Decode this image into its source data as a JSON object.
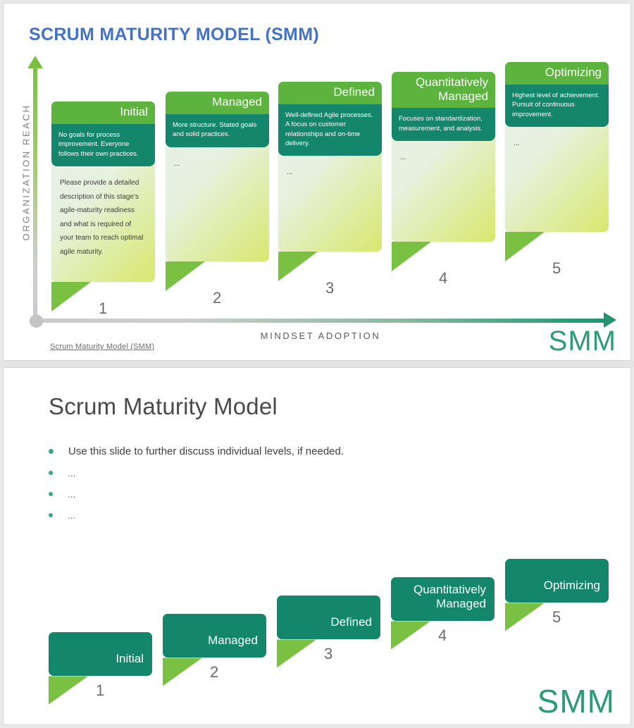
{
  "slide1": {
    "title": "SCRUM MATURITY MODEL  (SMM)",
    "y_axis_label": "ORGANIZATION REACH",
    "x_axis_label": "MINDSET ADOPTION",
    "footer_link": "Scrum Maturity Model  (SMM)",
    "logo": "SMM",
    "accent_blue": "#4472C4",
    "accent_green": "#7ac143",
    "accent_teal": "#13866c",
    "header_green": "#5cb33d",
    "steps": [
      {
        "number": "1",
        "title": "Initial",
        "description": "No goals for process improvement. Everyone follows their own practices.",
        "body": "Please provide a detailed description of this stage's agile-maturity readiness and what is required of your team to reach optimal agile maturity."
      },
      {
        "number": "2",
        "title": "Managed",
        "description": "More structure. Stated goals and solid practices.",
        "body": "..."
      },
      {
        "number": "3",
        "title": "Defined",
        "description": "Well-defined Agile processes. A focus on customer relationships and on-time delivery.",
        "body": "..."
      },
      {
        "number": "4",
        "title": "Quantitatively Managed",
        "description": "Focuses on standardization, measurement, and analysis.",
        "body": "..."
      },
      {
        "number": "5",
        "title": "Optimizing",
        "description": "Highest level of achievement. Pursuit of continuous improvement.",
        "body": "..."
      }
    ]
  },
  "slide2": {
    "title": "Scrum Maturity Model",
    "logo": "SMM",
    "bullets": [
      "Use this slide to further discuss individual levels, if needed.",
      "...",
      "...",
      "..."
    ],
    "steps": [
      {
        "number": "1",
        "title": "Initial"
      },
      {
        "number": "2",
        "title": "Managed"
      },
      {
        "number": "3",
        "title": "Defined"
      },
      {
        "number": "4",
        "title": "Quantitatively Managed"
      },
      {
        "number": "5",
        "title": "Optimizing"
      }
    ]
  }
}
